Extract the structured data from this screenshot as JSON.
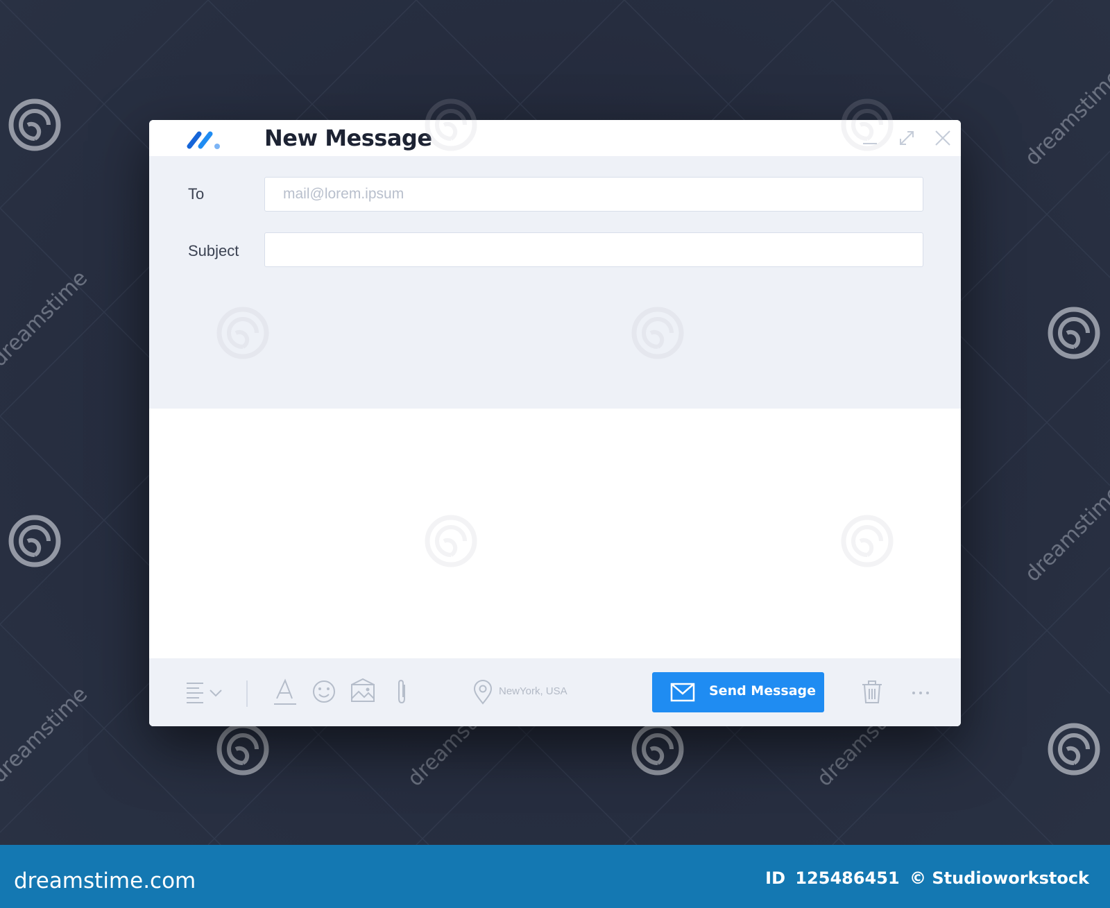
{
  "window": {
    "title": "New Message",
    "controls": [
      "minimize-icon",
      "maximize-icon",
      "close-icon"
    ]
  },
  "form": {
    "to_label": "To",
    "to_placeholder": "mail@lorem.ipsum",
    "to_value": "",
    "subject_label": "Subject",
    "subject_value": "",
    "body_value": ""
  },
  "toolbar": {
    "icons": [
      "align-icon",
      "text-format-icon",
      "emoji-icon",
      "image-icon",
      "attachment-icon",
      "location-pin-icon",
      "trash-icon",
      "more-icon"
    ],
    "location": "NewYork, USA",
    "send_label": "Send Message"
  },
  "watermark": {
    "brand": "dreamstime.com",
    "id_label": "ID",
    "id_value": "125486451",
    "copyright": "© Studioworkstock",
    "tile_text": "dreamstime"
  },
  "colors": {
    "background": "#262d3f",
    "panel": "#eef1f7",
    "accent": "#1f8cf2",
    "banner": "#1478b2",
    "title_text": "#1d2333"
  }
}
